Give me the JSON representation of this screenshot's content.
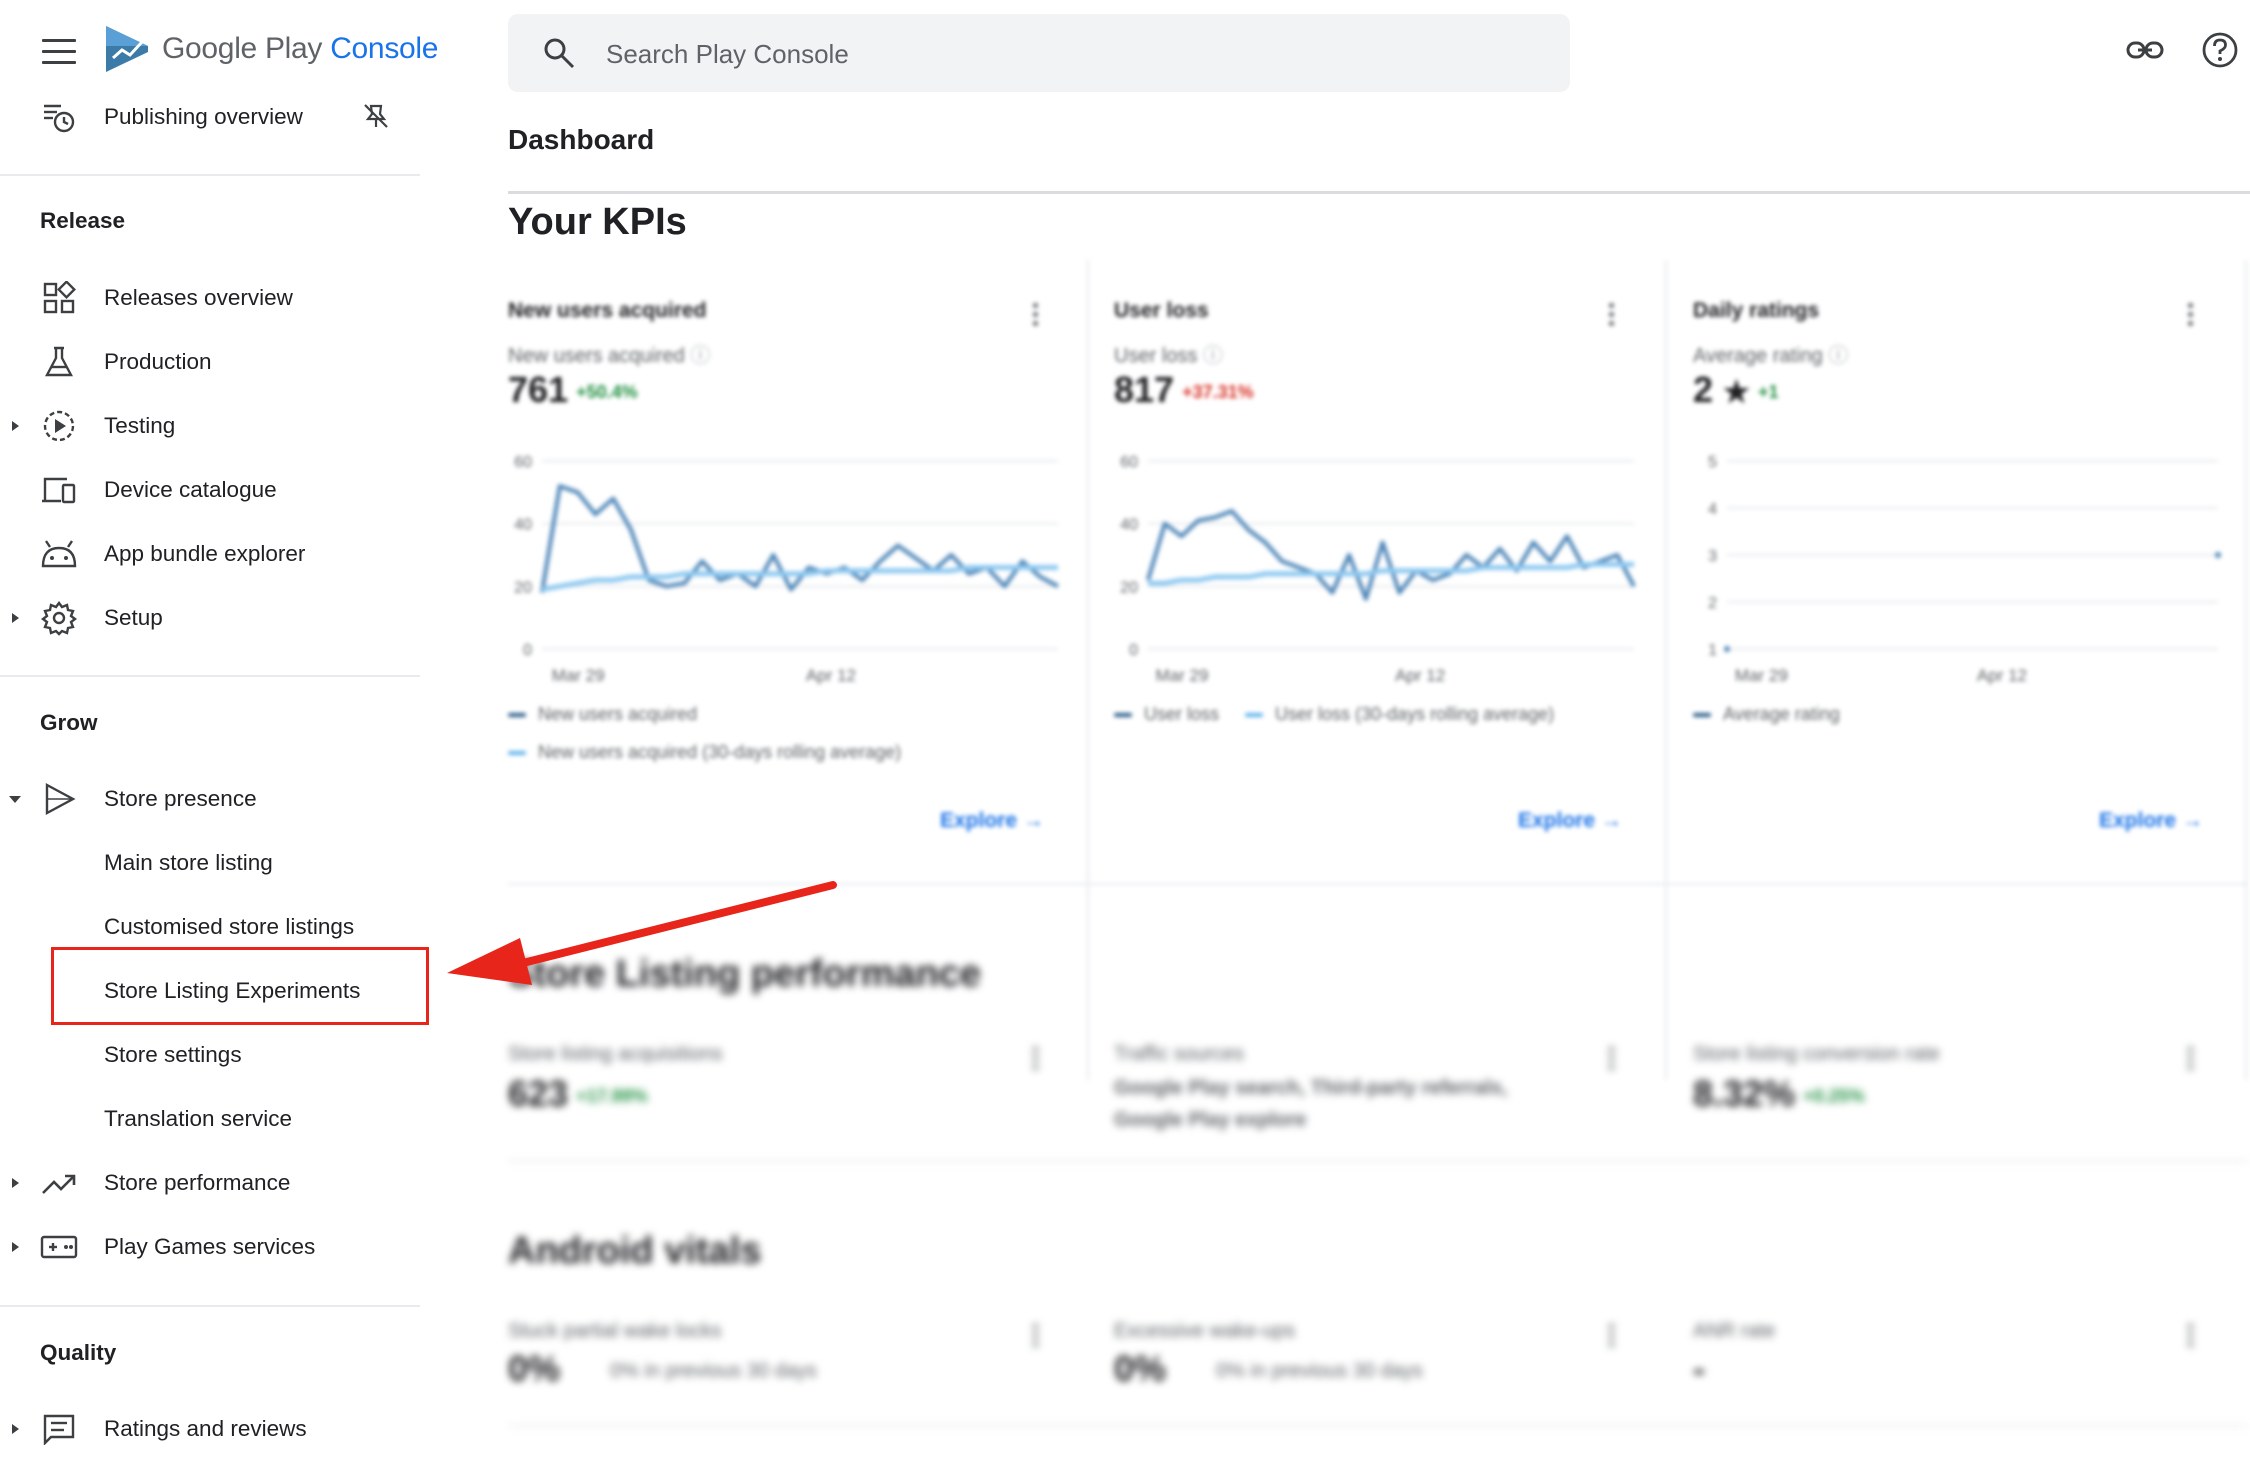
{
  "app": {
    "logo_main": "Google Play",
    "logo_accent": "Console"
  },
  "search": {
    "placeholder": "Search Play Console"
  },
  "page": {
    "title": "Dashboard"
  },
  "sidebar": {
    "top_item": {
      "label": "Publishing overview",
      "icon": "publishing-overview-icon"
    },
    "sections": [
      {
        "title": "Release",
        "items": [
          {
            "label": "Releases overview",
            "icon": "dashboard-grid-icon"
          },
          {
            "label": "Production",
            "icon": "flask-icon"
          },
          {
            "label": "Testing",
            "icon": "play-circle-icon",
            "expandable": true
          },
          {
            "label": "Device catalogue",
            "icon": "devices-icon"
          },
          {
            "label": "App bundle explorer",
            "icon": "android-icon"
          },
          {
            "label": "Setup",
            "icon": "gear-icon",
            "expandable": true
          }
        ]
      },
      {
        "title": "Grow",
        "items": [
          {
            "label": "Store presence",
            "icon": "play-triangle-icon",
            "expanded": true
          },
          {
            "label": "Main store listing"
          },
          {
            "label": "Customised store listings"
          },
          {
            "label": "Store Listing Experiments",
            "highlighted": true
          },
          {
            "label": "Store settings"
          },
          {
            "label": "Translation service"
          },
          {
            "label": "Store performance",
            "icon": "trending-up-icon",
            "expandable": true
          },
          {
            "label": "Play Games services",
            "icon": "gamepad-icon",
            "expandable": true
          }
        ]
      },
      {
        "title": "Quality",
        "items": [
          {
            "label": "Ratings and reviews",
            "icon": "reviews-icon",
            "expandable": true
          }
        ]
      }
    ]
  },
  "kpis": {
    "heading": "Your KPIs",
    "explore_label": "Explore",
    "cards": [
      {
        "title": "New users acquired",
        "subtitle": "New users acquired",
        "value": "761",
        "delta": "+50.4%",
        "delta_type": "pos",
        "legend": [
          "New users acquired",
          "New users acquired (30-days rolling average)"
        ]
      },
      {
        "title": "User loss",
        "subtitle": "User loss",
        "value": "817",
        "delta": "+37.31%",
        "delta_type": "neg",
        "legend": [
          "User loss",
          "User loss (30-days rolling average)"
        ]
      },
      {
        "title": "Daily ratings",
        "subtitle": "Average rating",
        "value": "2",
        "delta": "+1",
        "delta_type": "pos",
        "legend": [
          "Average rating"
        ]
      }
    ]
  },
  "chart_data": [
    {
      "type": "line",
      "title": "New users acquired",
      "x_ticks": [
        "Mar 29",
        "Apr 12"
      ],
      "ylim": [
        0,
        60
      ],
      "y_ticks": [
        0,
        20,
        40,
        60
      ],
      "series": [
        {
          "name": "New users acquired",
          "values": [
            18,
            52,
            50,
            43,
            48,
            38,
            22,
            20,
            21,
            28,
            22,
            24,
            20,
            30,
            19,
            26,
            24,
            26,
            22,
            28,
            33,
            29,
            25,
            30,
            24,
            26,
            20,
            28,
            23,
            20
          ]
        },
        {
          "name": "New users acquired (30-days rolling average)",
          "values": [
            19,
            20,
            21,
            22,
            22,
            23,
            23,
            23,
            24,
            24,
            24,
            24,
            24,
            24,
            24,
            24,
            25,
            25,
            25,
            25,
            25,
            25,
            25,
            25,
            26,
            26,
            26,
            26,
            26,
            26
          ]
        }
      ]
    },
    {
      "type": "line",
      "title": "User loss",
      "x_ticks": [
        "Mar 29",
        "Apr 12"
      ],
      "ylim": [
        0,
        60
      ],
      "y_ticks": [
        0,
        20,
        40,
        60
      ],
      "series": [
        {
          "name": "User loss",
          "values": [
            22,
            40,
            36,
            41,
            42,
            44,
            38,
            34,
            28,
            26,
            24,
            18,
            30,
            16,
            34,
            18,
            25,
            22,
            24,
            30,
            26,
            32,
            25,
            34,
            28,
            36,
            26,
            28,
            30,
            20
          ]
        },
        {
          "name": "User loss (30-days rolling average)",
          "values": [
            21,
            21,
            22,
            22,
            23,
            23,
            23,
            24,
            24,
            24,
            24,
            24,
            24,
            24,
            25,
            25,
            25,
            25,
            25,
            25,
            26,
            26,
            26,
            26,
            26,
            26,
            27,
            27,
            27,
            27
          ]
        }
      ]
    },
    {
      "type": "scatter",
      "title": "Daily ratings",
      "x_ticks": [
        "Mar 29",
        "Apr 12"
      ],
      "ylim": [
        1,
        5
      ],
      "y_ticks": [
        1,
        2,
        3,
        4,
        5
      ],
      "series": [
        {
          "name": "Average rating",
          "values": [
            {
              "x": 1,
              "y": 1
            },
            {
              "x": 30,
              "y": 3
            }
          ]
        }
      ]
    }
  ],
  "listing": {
    "heading": "Store Listing performance",
    "cards": [
      {
        "title": "Store listing acquisitions",
        "value": "623",
        "delta": "+17.99%"
      },
      {
        "title": "Traffic sources",
        "text_line1": "Google Play search, Third-party referrals,",
        "text_line2": "Google Play explore"
      },
      {
        "title": "Store listing conversion rate",
        "value": "8.32%",
        "delta": "+0.25%"
      }
    ]
  },
  "vitals": {
    "heading": "Android vitals",
    "cards": [
      {
        "title": "Stuck partial wake locks",
        "value": "0%",
        "note": "0% in previous 30 days"
      },
      {
        "title": "Excessive wake-ups",
        "value": "0%",
        "note": "0% in previous 30 days"
      },
      {
        "title": "ANR rate",
        "value": "-"
      }
    ]
  },
  "colors": {
    "accent": "#1a73e8",
    "series_dark": "#4e86b8",
    "series_light": "#8cc8f0",
    "highlight": "#e8251b",
    "positive": "#1e8e3e",
    "negative": "#d93025"
  }
}
